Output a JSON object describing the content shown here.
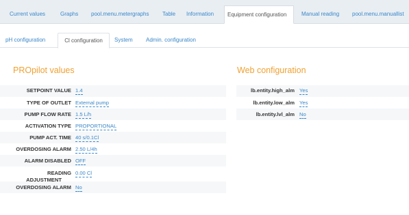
{
  "top_tabs": [
    {
      "label": "Current values"
    },
    {
      "label": "Graphs"
    },
    {
      "label": "pool.menu.metergraphs"
    },
    {
      "label": "Table"
    },
    {
      "label": "Information"
    },
    {
      "label": "Equipment configuration"
    },
    {
      "label": "Manual reading"
    },
    {
      "label": "pool.menu.manuallist"
    }
  ],
  "active_top_tab": "Equipment configuration",
  "sub_tabs": [
    {
      "label": "pH configuration"
    },
    {
      "label": "Cl configuration"
    },
    {
      "label": "System"
    },
    {
      "label": "Admin. configuration"
    }
  ],
  "active_sub_tab": "Cl configuration",
  "propilot": {
    "title": "PROpilot values",
    "rows": [
      {
        "label": "SETPOINT VALUE",
        "value": "1.4"
      },
      {
        "label": "TYPE OF OUTLET",
        "value": "External pump"
      },
      {
        "label": "PUMP FLOW RATE",
        "value": "1.5 L/h"
      },
      {
        "label": "ACTIVATION TYPE",
        "value": "PROPORTIONAL"
      },
      {
        "label": "PUMP ACT. TIME",
        "value": "40 s/0.1Cl"
      },
      {
        "label": "OVERDOSING ALARM",
        "value": "2.50 L/4h"
      },
      {
        "label": "ALARM DISABLED",
        "value": "OFF"
      },
      {
        "label": "READING",
        "label2": "ADJUSTMENT",
        "value": "0.00 Cl"
      },
      {
        "label": "OVERDOSING ALARM",
        "value": "No"
      }
    ]
  },
  "web": {
    "title": "Web configuration",
    "rows": [
      {
        "label": "lb.entity.high_alm",
        "value": "Yes"
      },
      {
        "label": "lb.entity.low_alm",
        "value": "Yes"
      },
      {
        "label": "lb.entity.lvl_alm",
        "value": "No"
      }
    ]
  }
}
